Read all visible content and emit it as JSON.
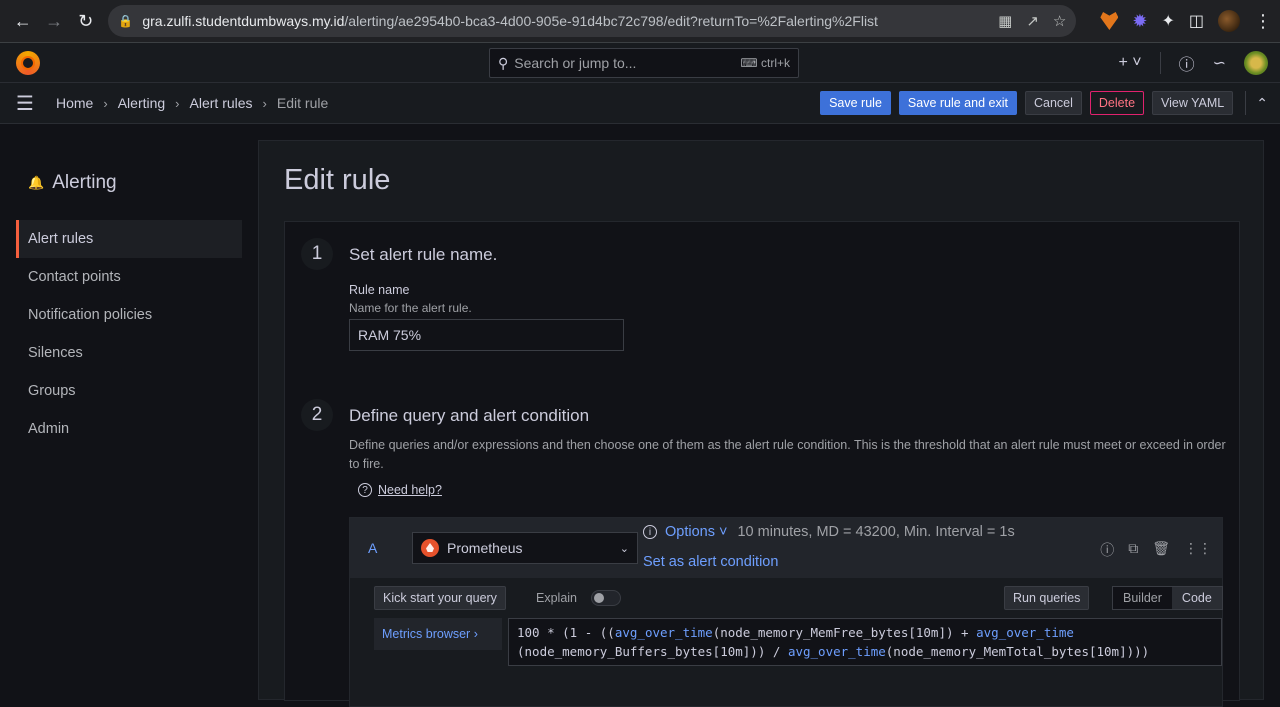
{
  "browser": {
    "url_host": "gra.zulfi.studentdumbways.my.id",
    "url_path": "/alerting/ae2954b0-bca3-4d00-905e-91d4bc72c798/edit?returnTo=%2Falerting%2Flist"
  },
  "topbar": {
    "search_placeholder": "Search or jump to...",
    "search_shortcut": "ctrl+k"
  },
  "breadcrumb": {
    "items": [
      "Home",
      "Alerting",
      "Alert rules"
    ],
    "current": "Edit rule"
  },
  "actions": {
    "save": "Save rule",
    "save_exit": "Save rule and exit",
    "cancel": "Cancel",
    "delete": "Delete",
    "yaml": "View YAML"
  },
  "sidebar": {
    "title": "Alerting",
    "items": [
      "Alert rules",
      "Contact points",
      "Notification policies",
      "Silences",
      "Groups",
      "Admin"
    ]
  },
  "page": {
    "title": "Edit rule"
  },
  "step1": {
    "num": "1",
    "title": "Set alert rule name.",
    "label": "Rule name",
    "desc": "Name for the alert rule.",
    "value": "RAM 75%"
  },
  "step2": {
    "num": "2",
    "title": "Define query and alert condition",
    "desc": "Define queries and/or expressions and then choose one of them as the alert rule condition. This is the threshold that an alert rule must meet or exceed in order to fire.",
    "help": "Need help?"
  },
  "query": {
    "letter": "A",
    "datasource": "Prometheus",
    "options": "Options",
    "options_summary": "10 minutes, MD = 43200, Min. Interval = 1s",
    "set_condition": "Set as alert condition",
    "kickstart": "Kick start your query",
    "explain": "Explain",
    "run": "Run queries",
    "mode_builder": "Builder",
    "mode_code": "Code",
    "metrics_browser": "Metrics browser",
    "code_line1_a": "100 * (1 - ((",
    "code_fn": "avg_over_time",
    "code_line1_b": "(node_memory_MemFree_bytes[10m]) + ",
    "code_line2_a": "(node_memory_Buffers_bytes[10m])) / ",
    "code_line2_b": "(node_memory_MemTotal_bytes[10m])))"
  }
}
